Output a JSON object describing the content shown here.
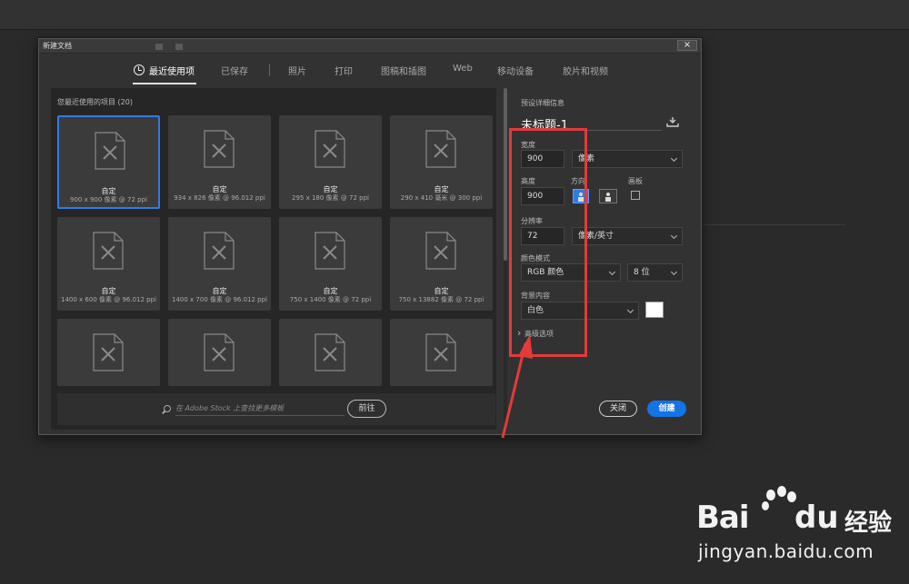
{
  "dialog": {
    "title": "新建文档",
    "close_glyph": "×"
  },
  "tabs": [
    {
      "label": "最近使用项",
      "active": true
    },
    {
      "label": "已保存"
    },
    {
      "label": "照片"
    },
    {
      "label": "打印"
    },
    {
      "label": "图稿和插图"
    },
    {
      "label": "Web"
    },
    {
      "label": "移动设备"
    },
    {
      "label": "胶片和视频"
    }
  ],
  "recent": {
    "heading": "您最近使用的项目 (20)",
    "items": [
      {
        "name": "自定",
        "size": "900 x 900 像素 @ 72 ppi"
      },
      {
        "name": "自定",
        "size": "934 x 826 像素 @ 96.012 ppi"
      },
      {
        "name": "自定",
        "size": "295 x 180 像素 @ 72 ppi"
      },
      {
        "name": "自定",
        "size": "290 x 410 毫米 @ 300 ppi"
      },
      {
        "name": "自定",
        "size": "1400 x 600 像素 @ 96.012 ppi"
      },
      {
        "name": "自定",
        "size": "1400 x 700 像素 @ 96.012 ppi"
      },
      {
        "name": "自定",
        "size": "750 x 1400 像素 @ 72 ppi"
      },
      {
        "name": "自定",
        "size": "750 x 13882 像素 @ 72 ppi"
      }
    ]
  },
  "search": {
    "placeholder": "在 Adobe Stock 上查找更多模板",
    "go_label": "前往"
  },
  "preset": {
    "section_label": "预设详细信息",
    "doc_title": "未标题-1",
    "width_label": "宽度",
    "width_value": "900",
    "width_unit": "像素",
    "height_label": "高度",
    "height_value": "900",
    "orientation_label": "方向",
    "artboard_label": "画板",
    "resolution_label": "分辨率",
    "resolution_value": "72",
    "resolution_unit": "像素/英寸",
    "color_mode_label": "颜色模式",
    "color_mode_value": "RGB 颜色",
    "bit_depth_value": "8 位",
    "background_label": "背景内容",
    "background_value": "白色",
    "background_color": "#ffffff",
    "advanced_label": "高级选项"
  },
  "buttons": {
    "close_label": "关闭",
    "create_label": "创建"
  },
  "watermark": {
    "brand_a": "Bai",
    "brand_b": "du",
    "brand_c": "经验",
    "url": "jingyan.baidu.com"
  },
  "colors": {
    "accent": "#1473e6",
    "highlight": "#e43a3a"
  }
}
